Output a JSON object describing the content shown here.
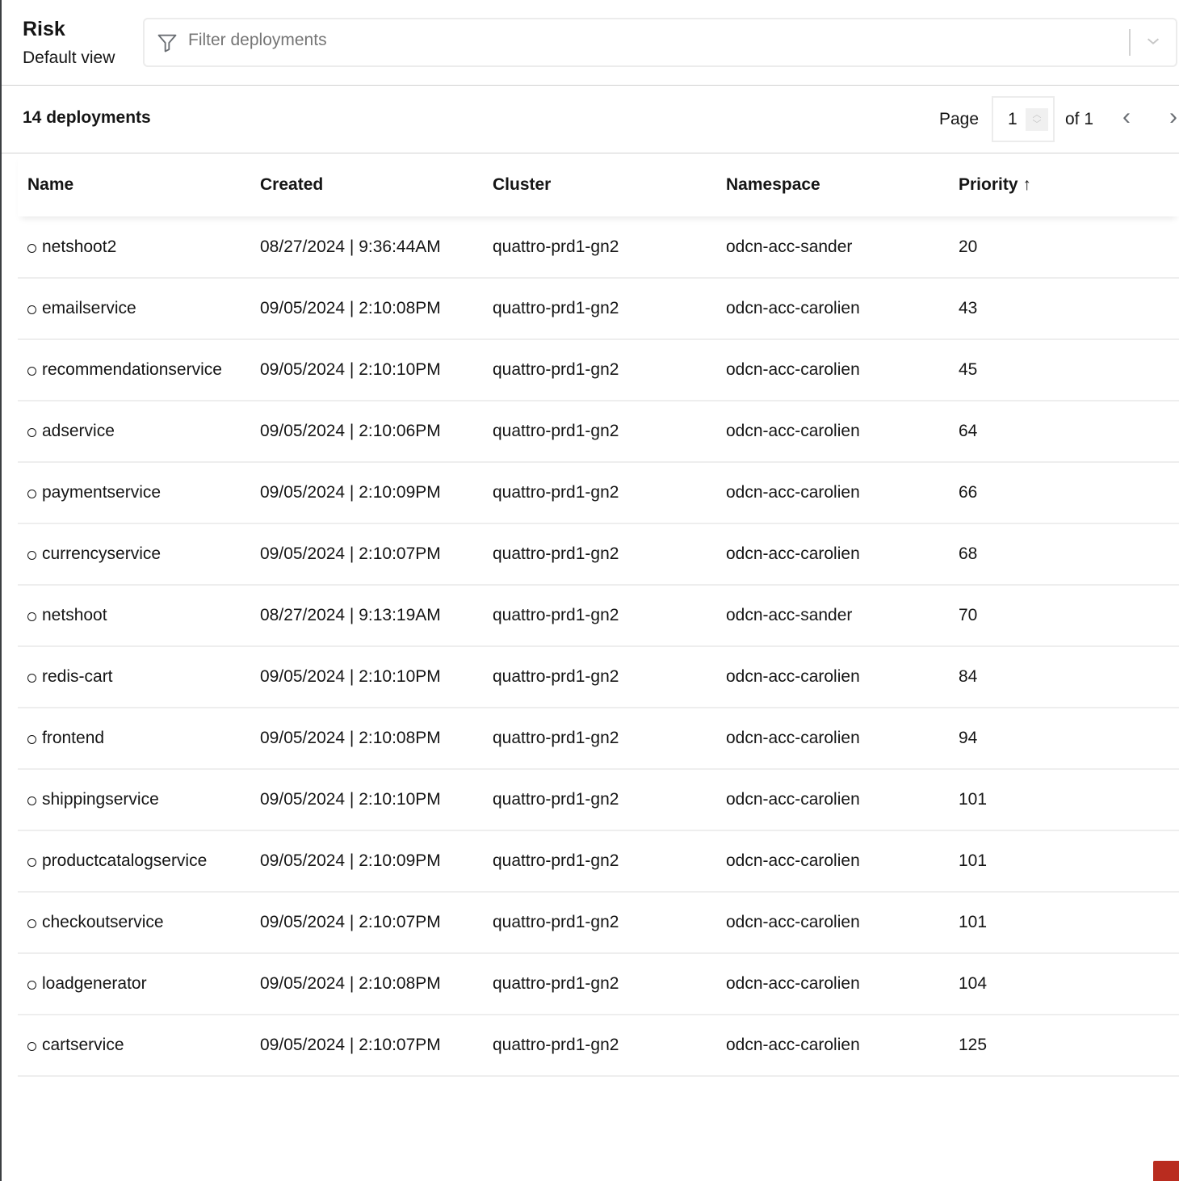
{
  "header": {
    "title": "Risk",
    "subtitle": "Default view",
    "filter_placeholder": "Filter deployments"
  },
  "toolbar": {
    "count": "14 deployments",
    "page_label": "Page",
    "page_value": "1",
    "of_label": "of 1"
  },
  "table": {
    "columns": [
      "Name",
      "Created",
      "Cluster",
      "Namespace",
      "Priority ↑"
    ],
    "rows": [
      [
        "netshoot2",
        "08/27/2024 | 9:36:44AM",
        "quattro-prd1-gn2",
        "odcn-acc-sander",
        "20"
      ],
      [
        "emailservice",
        "09/05/2024 | 2:10:08PM",
        "quattro-prd1-gn2",
        "odcn-acc-carolien",
        "43"
      ],
      [
        "recommendationservice",
        "09/05/2024 | 2:10:10PM",
        "quattro-prd1-gn2",
        "odcn-acc-carolien",
        "45"
      ],
      [
        "adservice",
        "09/05/2024 | 2:10:06PM",
        "quattro-prd1-gn2",
        "odcn-acc-carolien",
        "64"
      ],
      [
        "paymentservice",
        "09/05/2024 | 2:10:09PM",
        "quattro-prd1-gn2",
        "odcn-acc-carolien",
        "66"
      ],
      [
        "currencyservice",
        "09/05/2024 | 2:10:07PM",
        "quattro-prd1-gn2",
        "odcn-acc-carolien",
        "68"
      ],
      [
        "netshoot",
        "08/27/2024 | 9:13:19AM",
        "quattro-prd1-gn2",
        "odcn-acc-sander",
        "70"
      ],
      [
        "redis-cart",
        "09/05/2024 | 2:10:10PM",
        "quattro-prd1-gn2",
        "odcn-acc-carolien",
        "84"
      ],
      [
        "frontend",
        "09/05/2024 | 2:10:08PM",
        "quattro-prd1-gn2",
        "odcn-acc-carolien",
        "94"
      ],
      [
        "shippingservice",
        "09/05/2024 | 2:10:10PM",
        "quattro-prd1-gn2",
        "odcn-acc-carolien",
        "101"
      ],
      [
        "productcatalogservice",
        "09/05/2024 | 2:10:09PM",
        "quattro-prd1-gn2",
        "odcn-acc-carolien",
        "101"
      ],
      [
        "checkoutservice",
        "09/05/2024 | 2:10:07PM",
        "quattro-prd1-gn2",
        "odcn-acc-carolien",
        "101"
      ],
      [
        "loadgenerator",
        "09/05/2024 | 2:10:08PM",
        "quattro-prd1-gn2",
        "odcn-acc-carolien",
        "104"
      ],
      [
        "cartservice",
        "09/05/2024 | 2:10:07PM",
        "quattro-prd1-gn2",
        "odcn-acc-carolien",
        "125"
      ]
    ]
  }
}
